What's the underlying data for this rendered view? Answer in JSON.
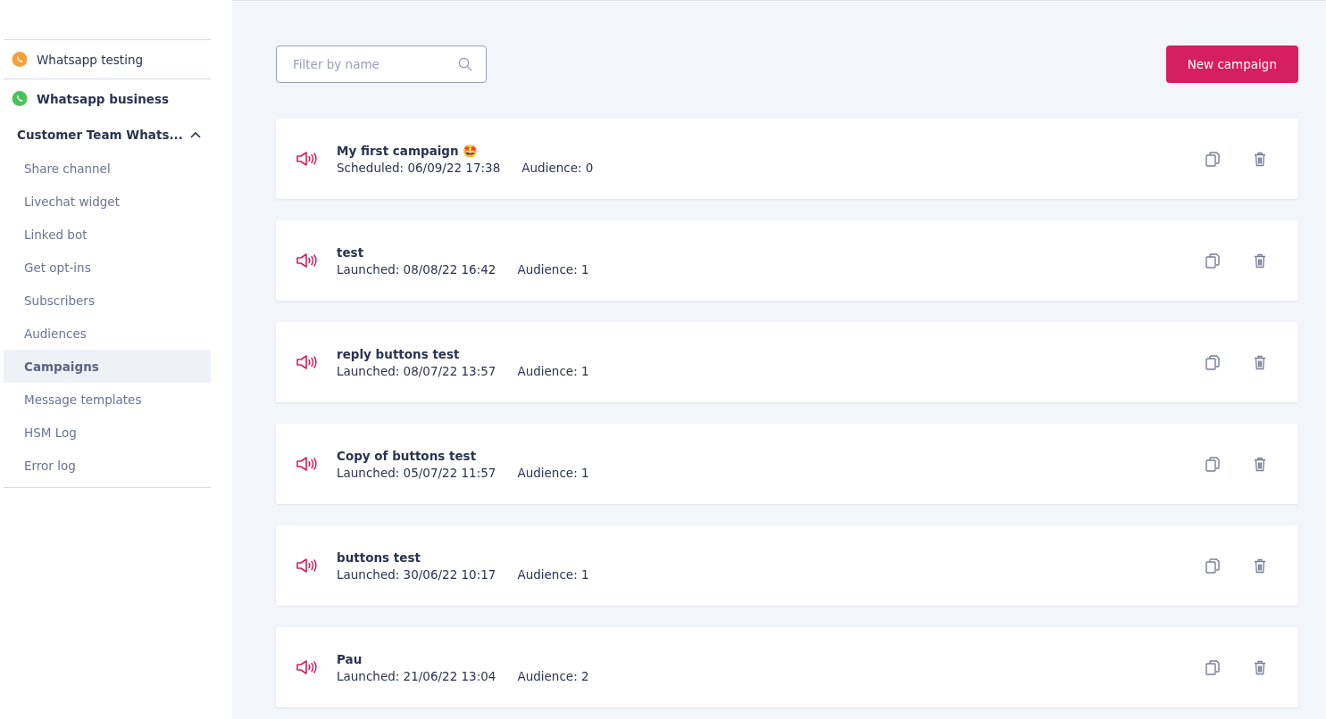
{
  "sidebar": {
    "channels": [
      {
        "label": "Whatsapp testing",
        "color": "#f5a03a",
        "selected": false
      },
      {
        "label": "Whatsapp business",
        "color": "#4cc35a",
        "selected": true
      }
    ],
    "group": {
      "label": "Customer Team Whats...",
      "expanded": true
    },
    "items": [
      {
        "label": "Share channel",
        "selected": false
      },
      {
        "label": "Livechat widget",
        "selected": false
      },
      {
        "label": "Linked bot",
        "selected": false
      },
      {
        "label": "Get opt-ins",
        "selected": false
      },
      {
        "label": "Subscribers",
        "selected": false
      },
      {
        "label": "Audiences",
        "selected": false
      },
      {
        "label": "Campaigns",
        "selected": true
      },
      {
        "label": "Message templates",
        "selected": false
      },
      {
        "label": "HSM Log",
        "selected": false
      },
      {
        "label": "Error log",
        "selected": false
      }
    ]
  },
  "search": {
    "placeholder": "Filter by name"
  },
  "new_button": "New campaign",
  "campaigns": [
    {
      "title": "My first campaign 🤩",
      "status": "Scheduled: 06/09/22 17:38",
      "audience": "Audience: 0"
    },
    {
      "title": "test",
      "status": "Launched: 08/08/22 16:42",
      "audience": "Audience: 1"
    },
    {
      "title": "reply buttons test",
      "status": "Launched: 08/07/22 13:57",
      "audience": "Audience: 1"
    },
    {
      "title": "Copy of buttons test",
      "status": "Launched: 05/07/22 11:57",
      "audience": "Audience: 1"
    },
    {
      "title": "buttons test",
      "status": "Launched: 30/06/22 10:17",
      "audience": "Audience: 1"
    },
    {
      "title": "Pau",
      "status": "Launched: 21/06/22 13:04",
      "audience": "Audience: 2"
    }
  ]
}
